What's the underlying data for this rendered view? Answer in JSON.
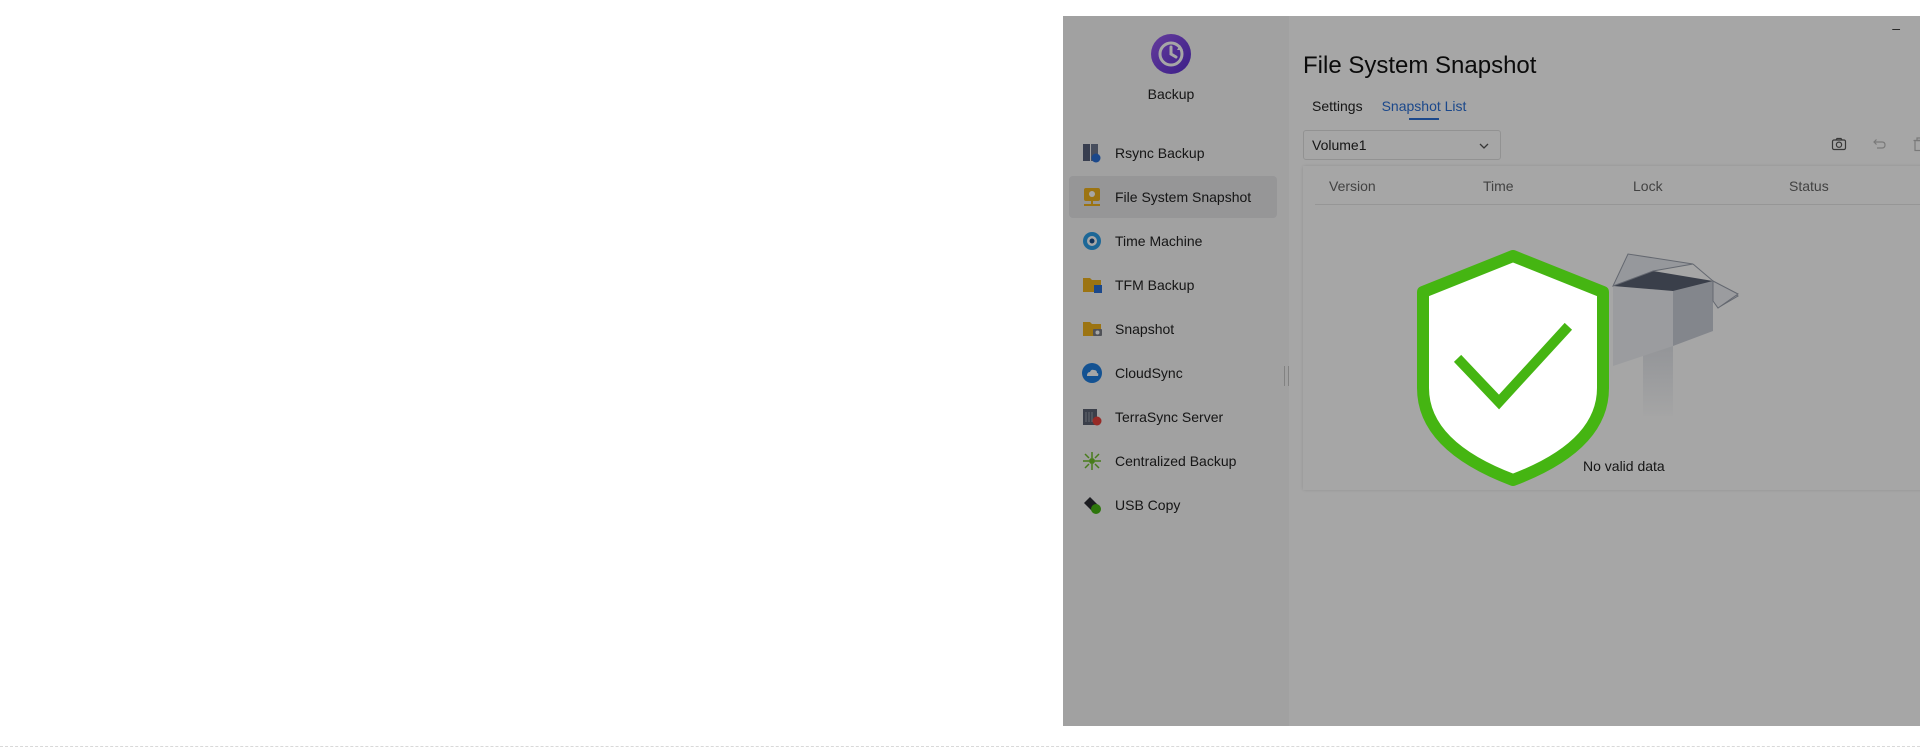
{
  "app": {
    "name": "Backup",
    "minimize_label": "–"
  },
  "sidebar": {
    "items": [
      {
        "label": "Rsync Backup",
        "icon": "rsync-icon",
        "active": false
      },
      {
        "label": "File System Snapshot",
        "icon": "file-system-snapshot-icon",
        "active": true
      },
      {
        "label": "Time Machine",
        "icon": "time-machine-icon",
        "active": false
      },
      {
        "label": "TFM Backup",
        "icon": "tfm-backup-icon",
        "active": false
      },
      {
        "label": "Snapshot",
        "icon": "snapshot-folder-icon",
        "active": false
      },
      {
        "label": "CloudSync",
        "icon": "cloudsync-icon",
        "active": false
      },
      {
        "label": "TerraSync Server",
        "icon": "terrasync-server-icon",
        "active": false
      },
      {
        "label": "Centralized Backup",
        "icon": "centralized-backup-icon",
        "active": false
      },
      {
        "label": "USB Copy",
        "icon": "usb-copy-icon",
        "active": false
      }
    ]
  },
  "main": {
    "title": "File System Snapshot",
    "tabs": [
      {
        "label": "Settings",
        "active": false
      },
      {
        "label": "Snapshot List",
        "active": true
      }
    ],
    "volume_select": {
      "value": "Volume1"
    },
    "toolbar": [
      "camera-icon",
      "restore-icon",
      "delete-icon"
    ],
    "table": {
      "columns": [
        "Version",
        "Time",
        "Lock",
        "Status"
      ],
      "empty_text": "No valid data"
    }
  },
  "overlay": {
    "icon": "shield-check-icon",
    "color": "#45b512"
  },
  "colors": {
    "accent": "#2a6fd6",
    "overlay_dim": "rgba(0,0,0,0.35)"
  }
}
